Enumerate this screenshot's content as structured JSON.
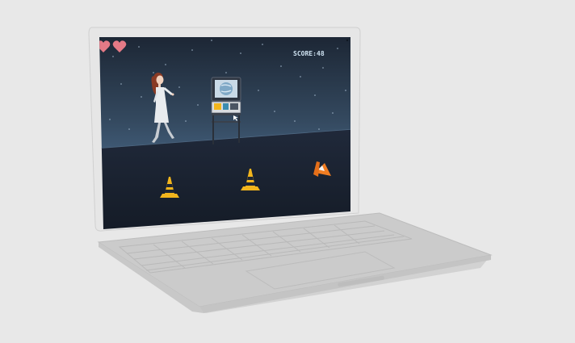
{
  "app": {
    "score_label": "SCORE:",
    "score_value": "48",
    "lives": {
      "current": 2,
      "icon": "heart-icon"
    }
  },
  "scene": {
    "player": "woman-character",
    "props": [
      "tv-monitor-cart",
      "traffic-cone",
      "traffic-cone",
      "knocked-over-traffic-cone"
    ]
  },
  "colors": {
    "sky_top": "#1c2634",
    "sky_bottom": "#3b5572",
    "floor": "#1a2330",
    "cone_yellow": "#f2b51d",
    "cone_orange": "#f07d22",
    "heart": "#e57a86",
    "score_text": "#cfe3f2",
    "laptop_shell": "#d6d6d6"
  }
}
